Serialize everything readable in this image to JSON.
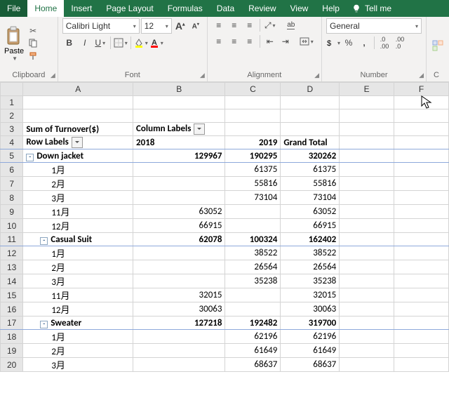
{
  "tabs": {
    "file": "File",
    "home": "Home",
    "insert": "Insert",
    "pageLayout": "Page Layout",
    "formulas": "Formulas",
    "data": "Data",
    "review": "Review",
    "view": "View",
    "help": "Help",
    "tell": "Tell me"
  },
  "ribbon": {
    "clipboard": {
      "label": "Clipboard",
      "paste": "Paste"
    },
    "font": {
      "label": "Font",
      "name": "Calibri Light",
      "size": "12",
      "bold": "B",
      "italic": "I",
      "underline": "U"
    },
    "alignment": {
      "label": "Alignment",
      "wrap": "ab"
    },
    "number": {
      "label": "Number",
      "format": "General",
      "percent": "%",
      "comma": ","
    }
  },
  "columns": [
    "A",
    "B",
    "C",
    "D",
    "E",
    "F"
  ],
  "pivot": {
    "measure": "Sum of Turnover($)",
    "colLabel": "Column Labels",
    "rowLabel": "Row Labels",
    "years": {
      "y18": "2018",
      "y19": "2019",
      "gt": "Grand Total"
    }
  },
  "rows": [
    {
      "n": "1"
    },
    {
      "n": "2"
    },
    {
      "n": "3",
      "a_measure": true,
      "b_collabel": true
    },
    {
      "n": "4",
      "a_rowlabel": true,
      "b": "2018",
      "c": "2019",
      "d": "Grand Total",
      "hdr": true
    },
    {
      "n": "5",
      "a": "Down jacket",
      "b": "129967",
      "c": "190295",
      "d": "320262",
      "bold": true,
      "tog": "-",
      "bb": true
    },
    {
      "n": "6",
      "a": "1月",
      "c": "61375",
      "d": "61375",
      "ind": 2
    },
    {
      "n": "7",
      "a": "2月",
      "c": "55816",
      "d": "55816",
      "ind": 2
    },
    {
      "n": "8",
      "a": "3月",
      "c": "73104",
      "d": "73104",
      "ind": 2
    },
    {
      "n": "9",
      "a": "11月",
      "b": "63052",
      "d": "63052",
      "ind": 2
    },
    {
      "n": "10",
      "a": "12月",
      "b": "66915",
      "d": "66915",
      "ind": 2
    },
    {
      "n": "11",
      "a": "Casual Suit",
      "b": "62078",
      "c": "100324",
      "d": "162402",
      "bold": true,
      "tog": "-",
      "bb": true,
      "ind": 1
    },
    {
      "n": "12",
      "a": "1月",
      "c": "38522",
      "d": "38522",
      "ind": 2
    },
    {
      "n": "13",
      "a": "2月",
      "c": "26564",
      "d": "26564",
      "ind": 2
    },
    {
      "n": "14",
      "a": "3月",
      "c": "35238",
      "d": "35238",
      "ind": 2
    },
    {
      "n": "15",
      "a": "11月",
      "b": "32015",
      "d": "32015",
      "ind": 2
    },
    {
      "n": "16",
      "a": "12月",
      "b": "30063",
      "d": "30063",
      "ind": 2
    },
    {
      "n": "17",
      "a": "Sweater",
      "b": "127218",
      "c": "192482",
      "d": "319700",
      "bold": true,
      "tog": "-",
      "bb": true,
      "ind": 1
    },
    {
      "n": "18",
      "a": "1月",
      "c": "62196",
      "d": "62196",
      "ind": 2
    },
    {
      "n": "19",
      "a": "2月",
      "c": "61649",
      "d": "61649",
      "ind": 2
    },
    {
      "n": "20",
      "a": "3月",
      "c": "68637",
      "d": "68637",
      "ind": 2
    }
  ],
  "chart_data": {
    "type": "table",
    "title": "Sum of Turnover($)",
    "columns": [
      "Row Labels",
      "2018",
      "2019",
      "Grand Total"
    ],
    "groups": [
      {
        "name": "Down jacket",
        "2018": 129967,
        "2019": 190295,
        "Grand Total": 320262,
        "rows": [
          {
            "label": "1月",
            "2019": 61375,
            "Grand Total": 61375
          },
          {
            "label": "2月",
            "2019": 55816,
            "Grand Total": 55816
          },
          {
            "label": "3月",
            "2019": 73104,
            "Grand Total": 73104
          },
          {
            "label": "11月",
            "2018": 63052,
            "Grand Total": 63052
          },
          {
            "label": "12月",
            "2018": 66915,
            "Grand Total": 66915
          }
        ]
      },
      {
        "name": "Casual Suit",
        "2018": 62078,
        "2019": 100324,
        "Grand Total": 162402,
        "rows": [
          {
            "label": "1月",
            "2019": 38522,
            "Grand Total": 38522
          },
          {
            "label": "2月",
            "2019": 26564,
            "Grand Total": 26564
          },
          {
            "label": "3月",
            "2019": 35238,
            "Grand Total": 35238
          },
          {
            "label": "11月",
            "2018": 32015,
            "Grand Total": 32015
          },
          {
            "label": "12月",
            "2018": 30063,
            "Grand Total": 30063
          }
        ]
      },
      {
        "name": "Sweater",
        "2018": 127218,
        "2019": 192482,
        "Grand Total": 319700,
        "rows": [
          {
            "label": "1月",
            "2019": 62196,
            "Grand Total": 62196
          },
          {
            "label": "2月",
            "2019": 61649,
            "Grand Total": 61649
          },
          {
            "label": "3月",
            "2019": 68637,
            "Grand Total": 68637
          }
        ]
      }
    ]
  }
}
